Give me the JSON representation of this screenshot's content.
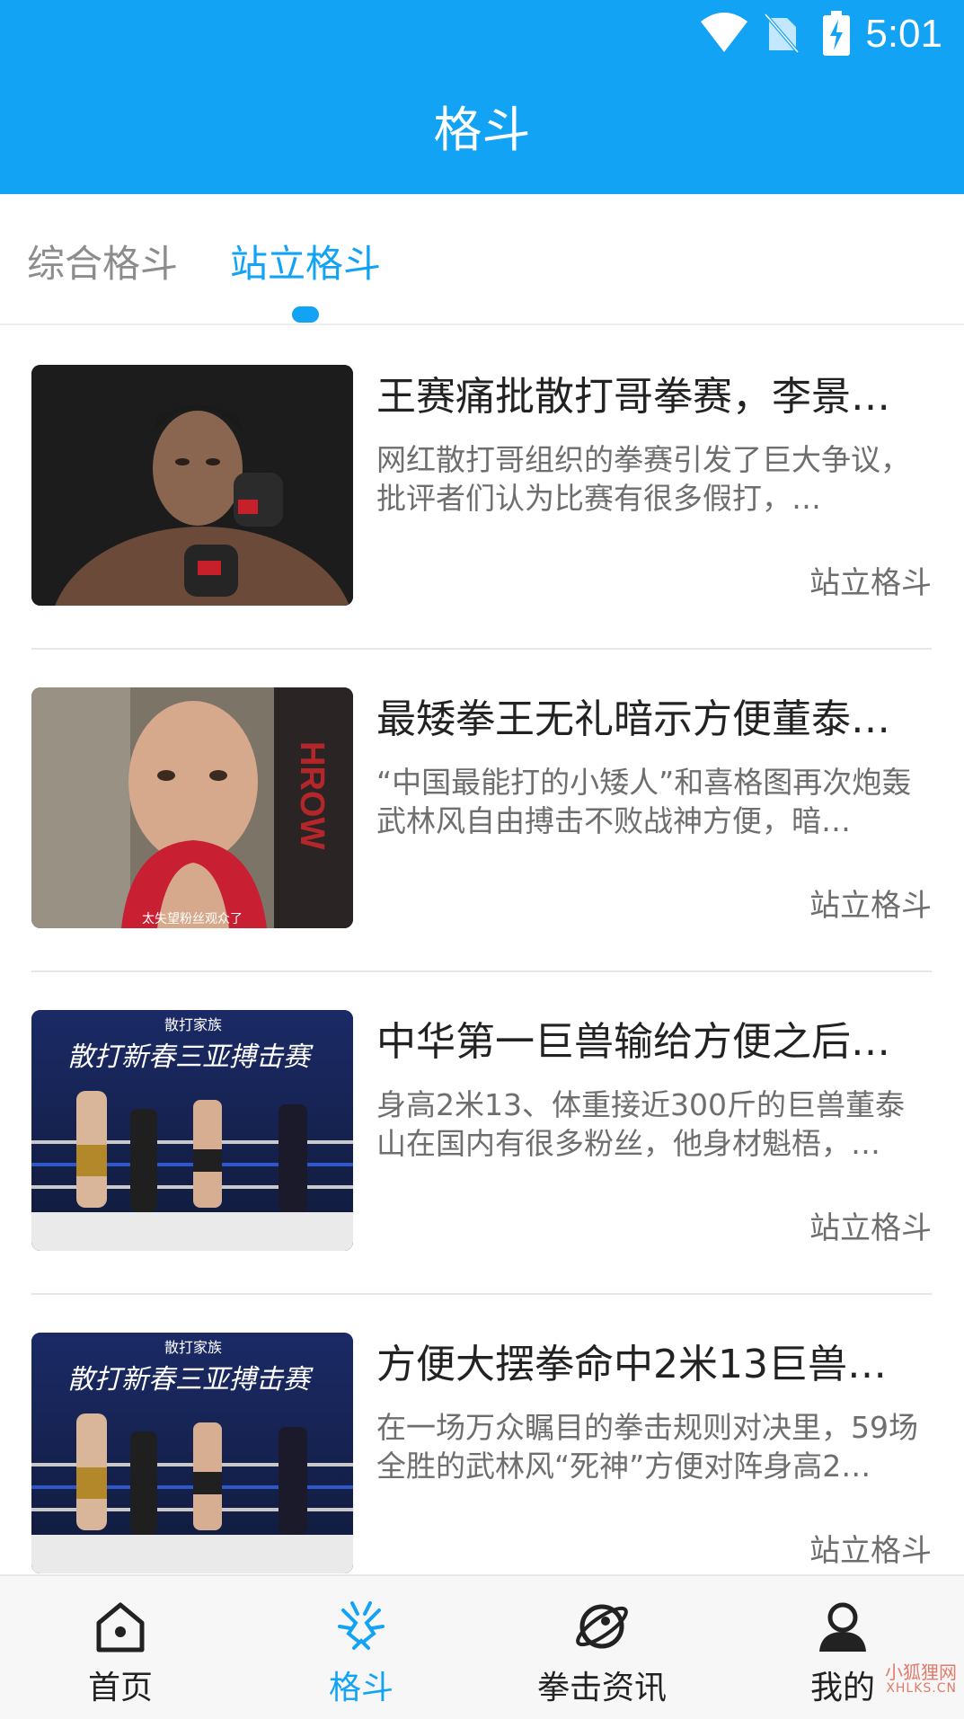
{
  "status_bar": {
    "time": "5:01",
    "icons": [
      "wifi-icon",
      "no-sim-icon",
      "battery-charging-icon"
    ]
  },
  "header": {
    "title": "格斗"
  },
  "tabs": [
    {
      "label": "综合格斗",
      "active": false
    },
    {
      "label": "站立格斗",
      "active": true
    }
  ],
  "articles": [
    {
      "title": "王赛痛批散打哥拳赛，李景…",
      "summary": "网红散打哥组织的拳赛引发了巨大争议，批评者们认为比赛有很多假打，…",
      "category": "站立格斗",
      "thumbnail": "fighter-portrait"
    },
    {
      "title": "最矮拳王无礼暗示方便董泰…",
      "summary": "“中国最能打的小矮人”和喜格图再次炮轰武林风自由搏击不败战神方便，暗…",
      "category": "站立格斗",
      "thumbnail": "fighter-closeup",
      "thumbnail_caption": "太失望粉丝观众了"
    },
    {
      "title": "中华第一巨兽输给方便之后…",
      "summary": "身高2米13、体重接近300斤的巨兽董泰山在国内有很多粉丝，他身材魁梧，…",
      "category": "站立格斗",
      "thumbnail": "boxing-ring",
      "thumbnail_banner": "散打家族",
      "thumbnail_headline": "散打新春三亚搏击赛"
    },
    {
      "title": "方便大摆拳命中2米13巨兽…",
      "summary": "在一场万众瞩目的拳击规则对决里，59场全胜的武林风“死神”方便对阵身高2…",
      "category": "站立格斗",
      "thumbnail": "boxing-ring",
      "thumbnail_banner": "散打家族",
      "thumbnail_headline": "散打新春三亚搏击赛"
    }
  ],
  "bottom_nav": [
    {
      "label": "首页",
      "icon": "home-icon",
      "active": false
    },
    {
      "label": "格斗",
      "icon": "fight-icon",
      "active": true
    },
    {
      "label": "拳击资讯",
      "icon": "planet-icon",
      "active": false
    },
    {
      "label": "我的",
      "icon": "profile-icon",
      "active": false
    }
  ],
  "watermark": {
    "text": "小狐狸网",
    "sub": "XHLKS.CN"
  },
  "colors": {
    "accent": "#12a3f5",
    "title_text": "#222222",
    "secondary_text": "#6e6e6e",
    "inactive_tab": "#8c8c8c"
  }
}
